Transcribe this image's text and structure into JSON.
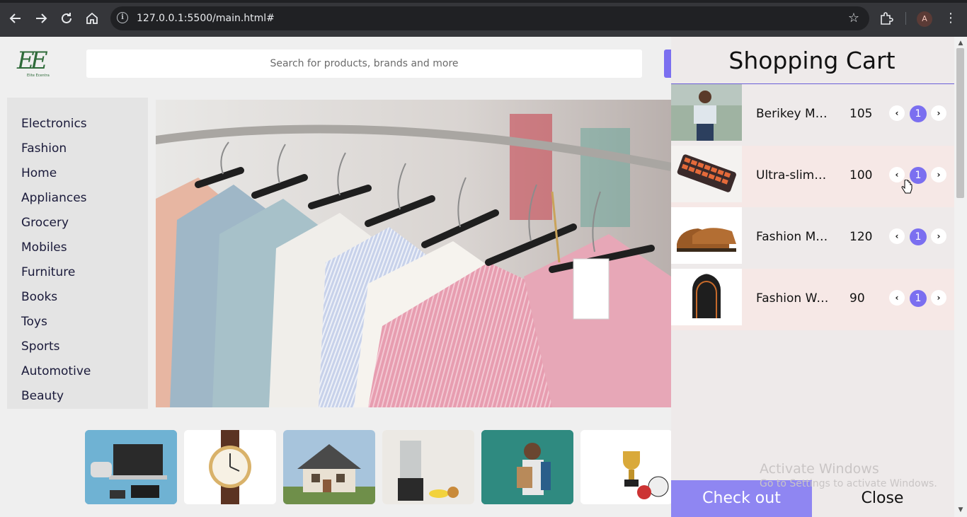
{
  "browser": {
    "url": "127.0.0.1:5500/main.html#",
    "profile_initial": "A",
    "icons": [
      "back-icon",
      "forward-icon",
      "reload-icon",
      "home-icon",
      "site-info-icon",
      "bookmark-star-icon",
      "extensions-icon",
      "menu-dots-icon"
    ]
  },
  "header": {
    "logo_text": "EE",
    "logo_tagline": "Elite Ecentra",
    "search_placeholder": "Search for products, brands and more"
  },
  "categories": [
    "Electronics",
    "Fashion",
    "Home",
    "Appliances",
    "Grocery",
    "Mobiles",
    "Furniture",
    "Books",
    "Toys",
    "Sports",
    "Automotive",
    "Beauty"
  ],
  "thumbnails": [
    "electronics-gadgets",
    "wrist-watch",
    "house",
    "blender-appliance",
    "student-with-books",
    "sports-trophy"
  ],
  "cart": {
    "title": "Shopping Cart",
    "items": [
      {
        "name": "Berikey Men...",
        "price": "105",
        "qty": "1"
      },
      {
        "name": "Ultra-slim k...",
        "price": "100",
        "qty": "1"
      },
      {
        "name": "Fashion Me...",
        "price": "120",
        "qty": "1"
      },
      {
        "name": "Fashion Wo...",
        "price": "90",
        "qty": "1"
      }
    ],
    "checkout_label": "Check out",
    "close_label": "Close"
  },
  "watermark": {
    "line1": "Activate Windows",
    "line2": "Go to Settings to activate Windows."
  },
  "colors": {
    "accent": "#7b6ff0",
    "checkout": "#8f86f2",
    "cart_bg": "#eeeaea",
    "chrome": "#35363a"
  }
}
